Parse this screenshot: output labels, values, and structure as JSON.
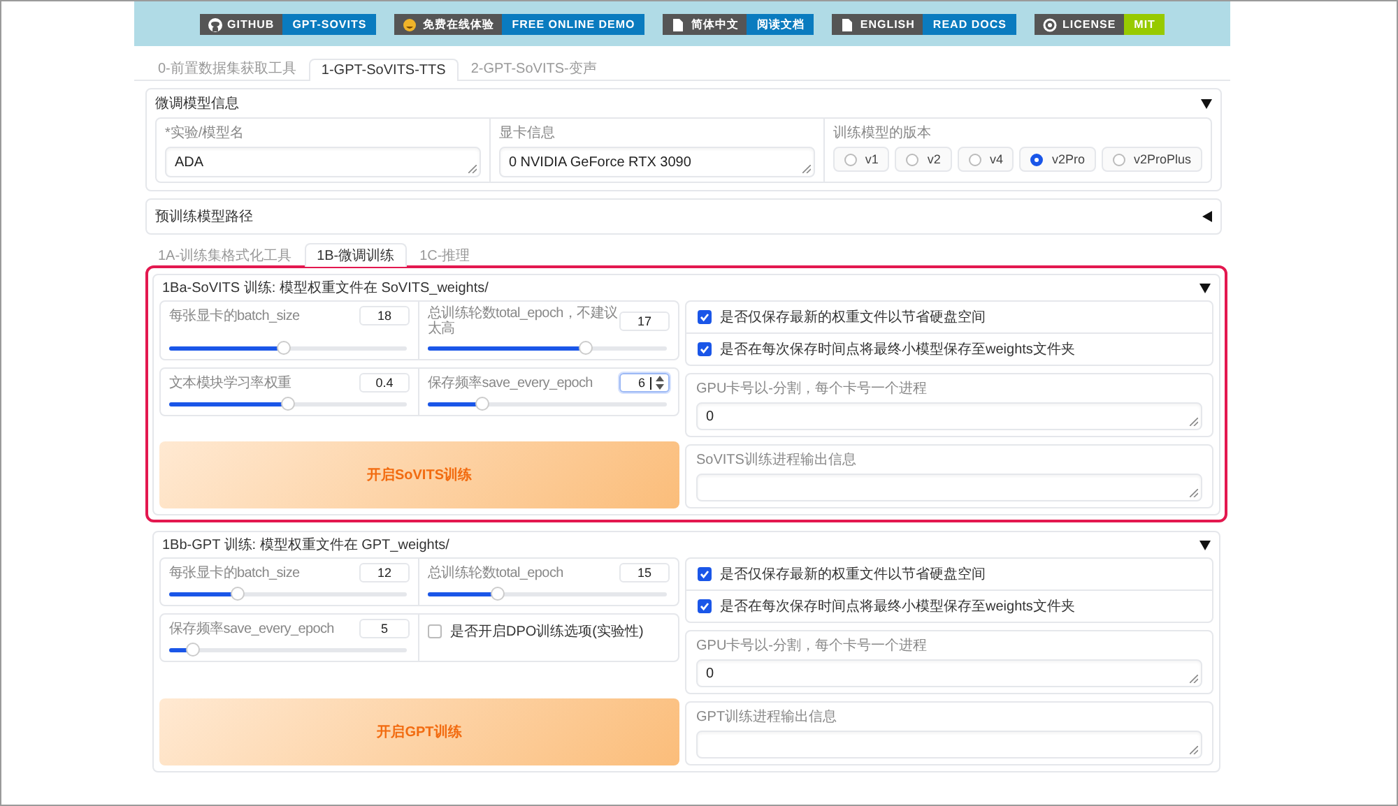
{
  "banner": {
    "badges": [
      {
        "kind": "github",
        "label": "GITHUB",
        "value": "GPT-SOVITS",
        "color": "#0a7bbf"
      },
      {
        "kind": "emoji",
        "label": "免费在线体验",
        "value": "FREE ONLINE DEMO",
        "color": "#0a7bbf"
      },
      {
        "kind": "document",
        "label": "简体中文",
        "value": "阅读文档",
        "color": "#0a7bbf"
      },
      {
        "kind": "document",
        "label": "ENGLISH",
        "value": "READ DOCS",
        "color": "#0a7bbf"
      },
      {
        "kind": "license",
        "label": "LICENSE",
        "value": "MIT",
        "color": "#97ca00"
      }
    ]
  },
  "tabs": [
    {
      "label": "0-前置数据集获取工具",
      "selected": false
    },
    {
      "label": "1-GPT-SoVITS-TTS",
      "selected": true
    },
    {
      "label": "2-GPT-SoVITS-变声",
      "selected": false
    }
  ],
  "model_info": {
    "title": "微调模型信息",
    "expanded": true,
    "name_field": {
      "label": "*实验/模型名",
      "value": "ADA"
    },
    "gpu_field": {
      "label": "显卡信息",
      "value": "0 NVIDIA GeForce RTX 3090"
    },
    "version": {
      "label": "训练模型的版本",
      "options": [
        {
          "label": "v1",
          "selected": false
        },
        {
          "label": "v2",
          "selected": false
        },
        {
          "label": "v4",
          "selected": false
        },
        {
          "label": "v2Pro",
          "selected": true
        },
        {
          "label": "v2ProPlus",
          "selected": false
        }
      ]
    }
  },
  "pretrained_path": {
    "title": "预训练模型路径",
    "expanded": false
  },
  "subtabs": [
    {
      "label": "1A-训练集格式化工具",
      "selected": false
    },
    {
      "label": "1B-微调训练",
      "selected": true
    },
    {
      "label": "1C-推理",
      "selected": false
    }
  ],
  "sections": [
    {
      "title": "1Ba-SoVITS 训练: 模型权重文件在 SoVITS_weights/",
      "expanded": true,
      "highlighted": true,
      "rows": [
        [
          {
            "kind": "slider",
            "label": "每张显卡的batch_size",
            "value": "18",
            "level": 0.48,
            "focused": false
          },
          {
            "kind": "slider",
            "label": "总训练轮数total_epoch，不建议太高",
            "value": "17",
            "level": 0.66,
            "focused": false
          }
        ],
        [
          {
            "kind": "slider",
            "label": "文本模块学习率权重",
            "value": "0.4",
            "level": 0.5,
            "focused": false
          },
          {
            "kind": "slider",
            "label": "保存频率save_every_epoch",
            "value": "6",
            "level": 0.23,
            "focused": true
          }
        ]
      ],
      "button": "开启SoVITS训练",
      "checkboxes": [
        {
          "label": "是否仅保存最新的权重文件以节省硬盘空间",
          "checked": true
        },
        {
          "label": "是否在每次保存时间点将最终小模型保存至weights文件夹",
          "checked": true
        }
      ],
      "gpu_field": {
        "label": "GPU卡号以-分割，每个卡号一个进程",
        "value": "0"
      },
      "output_field": {
        "label": "SoVITS训练进程输出信息"
      }
    },
    {
      "title": "1Bb-GPT 训练: 模型权重文件在 GPT_weights/",
      "expanded": true,
      "highlighted": false,
      "rows": [
        [
          {
            "kind": "slider",
            "label": "每张显卡的batch_size",
            "value": "12",
            "level": 0.29,
            "focused": false
          },
          {
            "kind": "slider",
            "label": "总训练轮数total_epoch",
            "value": "15",
            "level": 0.29,
            "focused": false
          }
        ],
        [
          {
            "kind": "slider",
            "label": "保存频率save_every_epoch",
            "value": "5",
            "level": 0.1,
            "focused": false
          },
          {
            "kind": "checkbox",
            "label": "是否开启DPO训练选项(实验性)",
            "checked": false
          }
        ]
      ],
      "button": "开启GPT训练",
      "checkboxes": [
        {
          "label": "是否仅保存最新的权重文件以节省硬盘空间",
          "checked": true
        },
        {
          "label": "是否在每次保存时间点将最终小模型保存至weights文件夹",
          "checked": true
        }
      ],
      "gpu_field": {
        "label": "GPU卡号以-分割，每个卡号一个进程",
        "value": "0"
      },
      "output_field": {
        "label": "GPT训练进程输出信息"
      }
    }
  ]
}
